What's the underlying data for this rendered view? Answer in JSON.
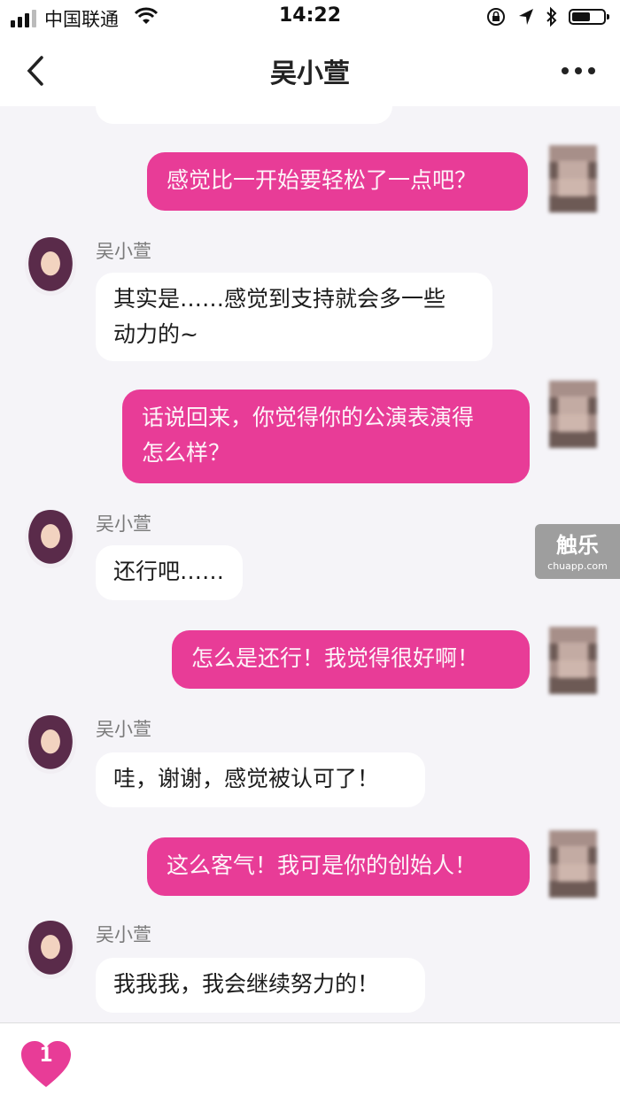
{
  "status_bar": {
    "carrier": "中国联通",
    "time": "14:22"
  },
  "nav": {
    "title": "吴小萱"
  },
  "colors": {
    "accent": "#e83c97",
    "incoming_bubble": "#ffffff",
    "background": "#f5f4f8"
  },
  "messages": [
    {
      "from": "me",
      "text": "感觉比一开始要轻松了一点吧？"
    },
    {
      "from": "吴小萱",
      "sender": "吴小萱",
      "lines": [
        "其实是……感觉到支持就会多一些",
        "动力的~"
      ]
    },
    {
      "from": "me",
      "lines": [
        "话说回来，你觉得你的公演表演得",
        "怎么样？"
      ]
    },
    {
      "from": "吴小萱",
      "sender": "吴小萱",
      "text": "还行吧……"
    },
    {
      "from": "me",
      "text": "怎么是还行！我觉得很好啊！"
    },
    {
      "from": "吴小萱",
      "sender": "吴小萱",
      "text": "哇，谢谢，感觉被认可了！"
    },
    {
      "from": "me",
      "text": "这么客气！我可是你的创始人！"
    },
    {
      "from": "吴小萱",
      "sender": "吴小萱",
      "text": "我我我，我会继续努力的！"
    }
  ],
  "watermark": {
    "title": "触乐",
    "subtitle": "chuapp.com"
  },
  "input_bar": {
    "heart_count": "1"
  },
  "icons": [
    "signal-icon",
    "wifi-icon",
    "lock-rotation-icon",
    "location-icon",
    "bluetooth-icon",
    "battery-icon",
    "back-icon",
    "more-icon",
    "heart-icon"
  ]
}
